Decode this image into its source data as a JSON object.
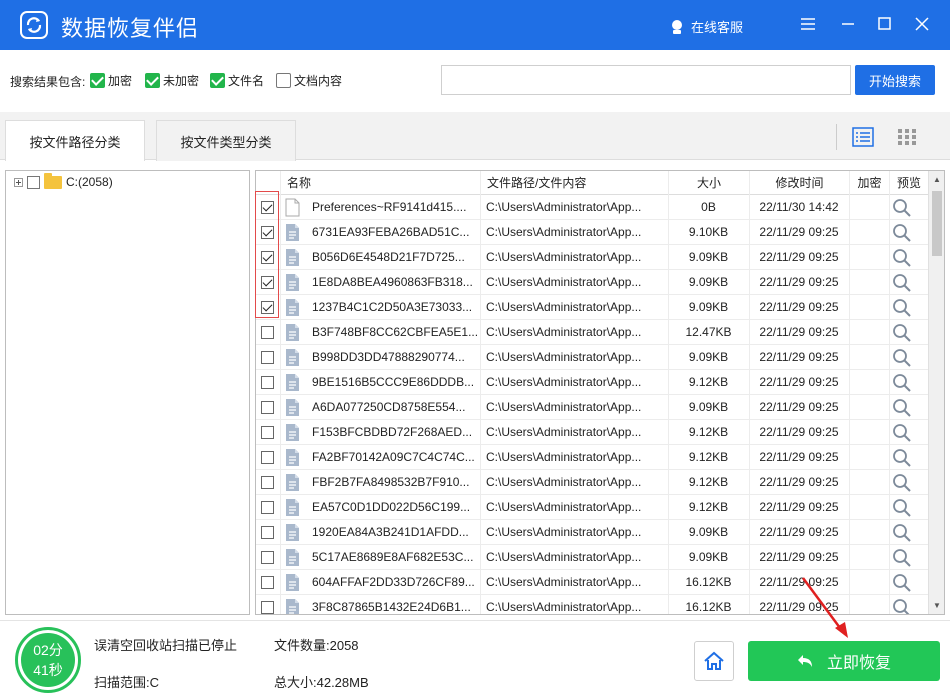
{
  "app": {
    "title": "数据恢复伴侣",
    "service": "在线客服"
  },
  "search": {
    "label": "搜索结果包含:",
    "filters": [
      {
        "label": "加密",
        "checked": true
      },
      {
        "label": "未加密",
        "checked": true
      },
      {
        "label": "文件名",
        "checked": true
      },
      {
        "label": "文档内容",
        "checked": false
      }
    ],
    "placeholder": "",
    "button": "开始搜索"
  },
  "tabs": [
    {
      "label": "按文件路径分类",
      "active": true
    },
    {
      "label": "按文件类型分类",
      "active": false
    }
  ],
  "tree": {
    "root": "C:(2058)"
  },
  "columns": {
    "name": "名称",
    "path": "文件路径/文件内容",
    "size": "大小",
    "mtime": "修改时间",
    "enc": "加密",
    "preview": "预览"
  },
  "rows": [
    {
      "checked": true,
      "icon": "blank-file-icon",
      "name": "Preferences~RF9141d415....",
      "path": "C:\\Users\\Administrator\\App...",
      "size": "0B",
      "mtime": "22/11/30 14:42"
    },
    {
      "checked": true,
      "icon": "doc-file-icon",
      "name": "6731EA93FEBA26BAD51C...",
      "path": "C:\\Users\\Administrator\\App...",
      "size": "9.10KB",
      "mtime": "22/11/29 09:25"
    },
    {
      "checked": true,
      "icon": "doc-file-icon",
      "name": "B056D6E4548D21F7D725...",
      "path": "C:\\Users\\Administrator\\App...",
      "size": "9.09KB",
      "mtime": "22/11/29 09:25"
    },
    {
      "checked": true,
      "icon": "doc-file-icon",
      "name": "1E8DA8BEA4960863FB318...",
      "path": "C:\\Users\\Administrator\\App...",
      "size": "9.09KB",
      "mtime": "22/11/29 09:25"
    },
    {
      "checked": true,
      "icon": "doc-file-icon",
      "name": "1237B4C1C2D50A3E73033...",
      "path": "C:\\Users\\Administrator\\App...",
      "size": "9.09KB",
      "mtime": "22/11/29 09:25"
    },
    {
      "checked": false,
      "icon": "doc-file-icon",
      "name": "B3F748BF8CC62CBFEA5E1...",
      "path": "C:\\Users\\Administrator\\App...",
      "size": "12.47KB",
      "mtime": "22/11/29 09:25"
    },
    {
      "checked": false,
      "icon": "doc-file-icon",
      "name": "B998DD3DD47888290774...",
      "path": "C:\\Users\\Administrator\\App...",
      "size": "9.09KB",
      "mtime": "22/11/29 09:25"
    },
    {
      "checked": false,
      "icon": "doc-file-icon",
      "name": "9BE1516B5CCC9E86DDDB...",
      "path": "C:\\Users\\Administrator\\App...",
      "size": "9.12KB",
      "mtime": "22/11/29 09:25"
    },
    {
      "checked": false,
      "icon": "doc-file-icon",
      "name": "A6DA077250CD8758E554...",
      "path": "C:\\Users\\Administrator\\App...",
      "size": "9.09KB",
      "mtime": "22/11/29 09:25"
    },
    {
      "checked": false,
      "icon": "doc-file-icon",
      "name": "F153BFCBDBD72F268AED...",
      "path": "C:\\Users\\Administrator\\App...",
      "size": "9.12KB",
      "mtime": "22/11/29 09:25"
    },
    {
      "checked": false,
      "icon": "doc-file-icon",
      "name": "FA2BF70142A09C7C4C74C...",
      "path": "C:\\Users\\Administrator\\App...",
      "size": "9.12KB",
      "mtime": "22/11/29 09:25"
    },
    {
      "checked": false,
      "icon": "doc-file-icon",
      "name": "FBF2B7FA8498532B7F910...",
      "path": "C:\\Users\\Administrator\\App...",
      "size": "9.12KB",
      "mtime": "22/11/29 09:25"
    },
    {
      "checked": false,
      "icon": "doc-file-icon",
      "name": "EA57C0D1DD022D56C199...",
      "path": "C:\\Users\\Administrator\\App...",
      "size": "9.12KB",
      "mtime": "22/11/29 09:25"
    },
    {
      "checked": false,
      "icon": "doc-file-icon",
      "name": "1920EA84A3B241D1AFDD...",
      "path": "C:\\Users\\Administrator\\App...",
      "size": "9.09KB",
      "mtime": "22/11/29 09:25"
    },
    {
      "checked": false,
      "icon": "doc-file-icon",
      "name": "5C17AE8689E8AF682E53C...",
      "path": "C:\\Users\\Administrator\\App...",
      "size": "9.09KB",
      "mtime": "22/11/29 09:25"
    },
    {
      "checked": false,
      "icon": "doc-file-icon",
      "name": "604AFFAF2DD33D726CF89...",
      "path": "C:\\Users\\Administrator\\App...",
      "size": "16.12KB",
      "mtime": "22/11/29 09:25"
    },
    {
      "checked": false,
      "icon": "doc-file-icon",
      "name": "3F8C87865B1432E24D6B1...",
      "path": "C:\\Users\\Administrator\\App...",
      "size": "16.12KB",
      "mtime": "22/11/29 09:25"
    }
  ],
  "status": {
    "timer_min": "02分",
    "timer_sec": "41秒",
    "message": "误清空回收站扫描已停止",
    "scope": "扫描范围:C",
    "count": "文件数量:2058",
    "total": "总大小:42.28MB"
  },
  "recover_button": "立即恢复",
  "colors": {
    "primary": "#1f6fe5",
    "success": "#22c757",
    "highlight": "#e34a4a"
  }
}
